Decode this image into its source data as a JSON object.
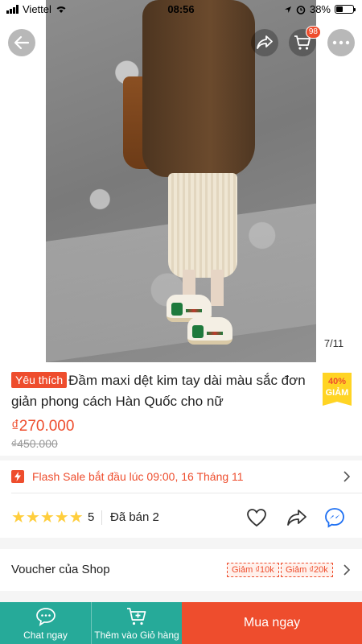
{
  "status_bar": {
    "carrier": "Viettel",
    "time": "08:56",
    "battery": "38%",
    "battery_level": 0.38
  },
  "header": {
    "cart_count": "98"
  },
  "image": {
    "counter": "7/11"
  },
  "product": {
    "badge": "Yêu thích",
    "title": "Đầm maxi dệt kim tay dài màu sắc đơn giản phong cách Hàn Quốc cho nữ",
    "discount_percent": "40%",
    "discount_label": "GIẢM",
    "price": "₫270.000",
    "old_price": "₫450.000"
  },
  "flash_sale": {
    "text": "Flash Sale bắt đầu lúc 09:00, 16 Tháng 11"
  },
  "rating": {
    "stars": "★★★★★",
    "score": "5",
    "sold": "Đã bán 2"
  },
  "voucher": {
    "label": "Voucher của Shop",
    "tags": [
      "Giảm ₫10k",
      "Giảm ₫20k"
    ]
  },
  "bottom_bar": {
    "chat": "Chat ngay",
    "add_to_cart": "Thêm vào Giỏ hàng",
    "buy_now": "Mua ngay"
  },
  "colors": {
    "accent": "#ee4d2d",
    "teal": "#26aa99",
    "star": "#ffce3d",
    "discount_bg": "#ffd424"
  }
}
